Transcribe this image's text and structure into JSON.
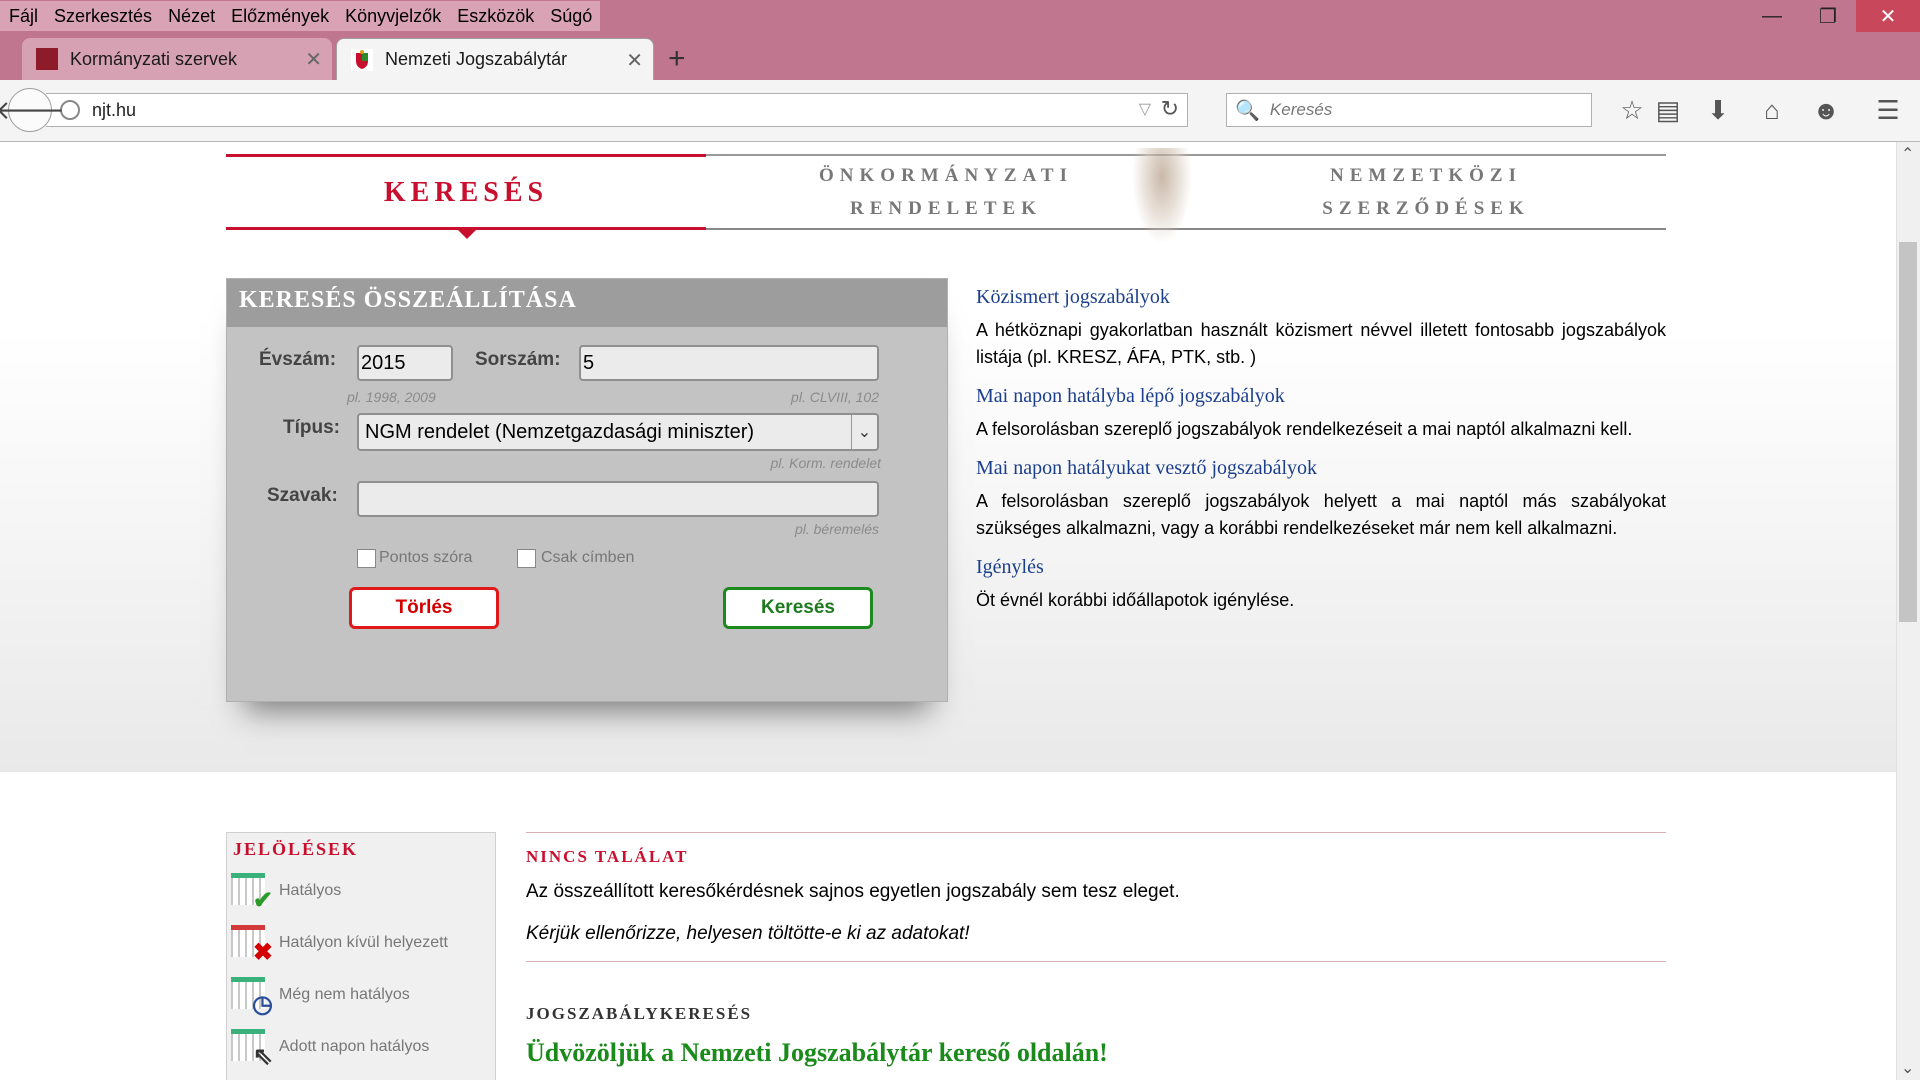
{
  "menu": [
    "Fájl",
    "Szerkesztés",
    "Nézet",
    "Előzmények",
    "Könyvjelzők",
    "Eszközök",
    "Súgó"
  ],
  "window_controls": {
    "minimize": "—",
    "restore": "❐",
    "close": "✕"
  },
  "tabs": [
    {
      "title": "Kormányzati szervek",
      "icon": "red-square-favicon"
    },
    {
      "title": "Nemzeti Jogszabálytár",
      "icon": "coat-of-arms-favicon"
    }
  ],
  "tab_close": "✕",
  "new_tab": "+",
  "navbar": {
    "back": "🡐",
    "url": "njt.hu",
    "url_dropdown": "▽",
    "reload": "↻",
    "search_placeholder": "Keresés",
    "search_icon": "🔍",
    "toolbar_icons": {
      "bookmark": "☆",
      "reading": "▤",
      "download": "⬇",
      "home": "⌂",
      "chat": "☻",
      "menu": "☰"
    }
  },
  "site_nav": {
    "tab1": "KERESÉS",
    "tab2_line1": "ÖNKORMÁNYZATI",
    "tab2_line2": "RENDELETEK",
    "tab3_line1": "NEMZETKÖZI",
    "tab3_line2": "SZERZŐDÉSEK"
  },
  "search_form": {
    "title": "KERESÉS ÖSSZEÁLLÍTÁSA",
    "evszam_label": "Évszám:",
    "evszam_value": "2015",
    "evszam_hint": "pl. 1998, 2009",
    "sorszam_label": "Sorszám:",
    "sorszam_value": "5",
    "sorszam_hint": "pl. CLVIII, 102",
    "tipus_label": "Típus:",
    "tipus_value": "NGM rendelet (Nemzetgazdasági miniszter)",
    "tipus_arrow": "⌄",
    "tipus_hint": "pl. Korm. rendelet",
    "szavak_label": "Szavak:",
    "szavak_value": "",
    "szavak_hint": "pl. béremelés",
    "pontos_label": "Pontos szóra",
    "csak_label": "Csak címben",
    "torles_button": "Törlés",
    "kereses_button": "Keresés"
  },
  "info": [
    {
      "head": "Közismert jogszabályok",
      "text": "A hétköznapi gyakorlatban használt közismert névvel illetett fontosabb jogszabályok listája (pl. KRESZ, ÁFA, PTK, stb. )"
    },
    {
      "head": "Mai napon hatályba lépő jogszabályok",
      "text": "A felsorolásban szereplő jogszabályok rendelkezéseit a mai naptól alkalmazni kell."
    },
    {
      "head": "Mai napon hatályukat vesztő jogszabályok",
      "text": "A felsorolásban szereplő jogszabályok helyett a mai naptól más szabályokat szükséges alkalmazni, vagy a korábbi rendelkezéseket már nem kell alkalmazni."
    },
    {
      "head": "Igénylés",
      "text": "Öt évnél korábbi időállapotok igénylése."
    }
  ],
  "legend": {
    "title": "JELÖLÉSEK",
    "items": [
      {
        "label": "Hatályos",
        "mark": "✔",
        "color": "#2a9a2a"
      },
      {
        "label": "Hatályon kívül helyezett",
        "mark": "✖",
        "color": "#d40000"
      },
      {
        "label": "Még nem hatályos",
        "mark": "◷",
        "color": "#2a4e9a"
      },
      {
        "label": "Adott napon hatályos",
        "mark": "⇖",
        "color": "#333333"
      }
    ]
  },
  "results": {
    "nincs_title": "NINCS TALÁLAT",
    "nincs_text": "Az összeállított keresőkérdésnek sajnos egyetlen jogszabály sem tesz eleget.",
    "nincs_check": "Kérjük ellenőrizze, helyesen töltötte-e ki az adatokat!",
    "jsz_title": "JOGSZABÁLYKERESÉS",
    "welcome": "Üdvözöljük a Nemzeti Jogszabálytár kereső oldalán!"
  },
  "scrollbar": {
    "up": "⌃",
    "down": "⌄"
  },
  "colors": {
    "chrome": "#c0768f",
    "accent_red": "#c8102e",
    "link_blue": "#1c3f8c",
    "green": "#1a8a1a"
  }
}
